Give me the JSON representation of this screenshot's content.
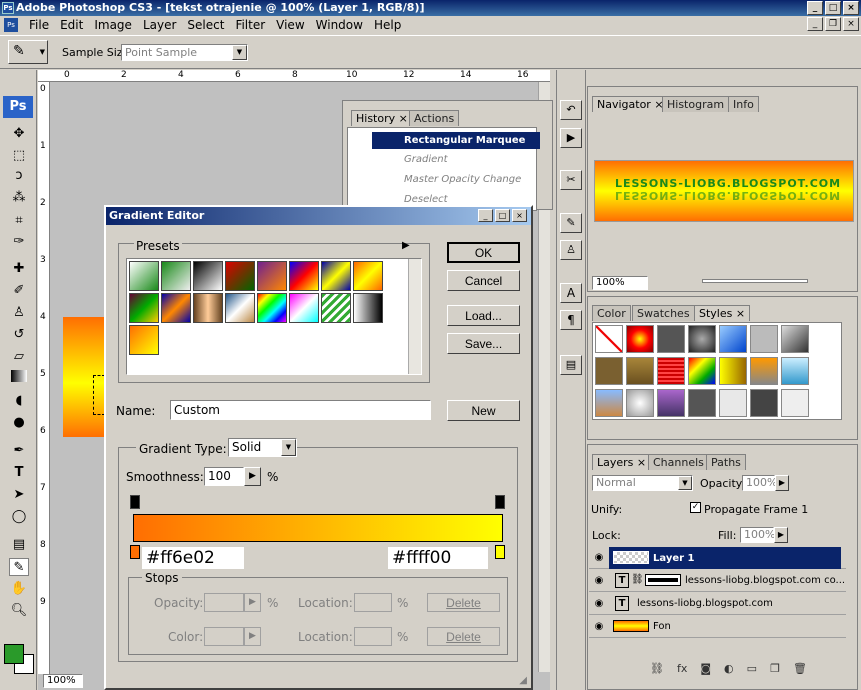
{
  "app": {
    "title": "Adobe Photoshop CS3 - [tekst otrajenie @ 100% (Layer 1, RGB/8)]",
    "logo": "Ps",
    "menu": [
      "File",
      "Edit",
      "Image",
      "Layer",
      "Select",
      "Filter",
      "View",
      "Window",
      "Help"
    ]
  },
  "options": {
    "sample_size_label": "Sample Size:",
    "sample_size_value": "Point Sample"
  },
  "ruler": {
    "ticks": [
      "0",
      "2",
      "4",
      "6",
      "8",
      "10",
      "12",
      "14",
      "16"
    ],
    "vticks": [
      "0",
      "1",
      "2",
      "3",
      "4",
      "5",
      "6",
      "7",
      "8",
      "9"
    ]
  },
  "history": {
    "tabs": [
      "History",
      "Actions"
    ],
    "items": [
      "Rectangular Marquee",
      "Gradient",
      "Master Opacity Change",
      "Deselect"
    ]
  },
  "gradient_editor": {
    "title": "Gradient Editor",
    "presets_label": "Presets",
    "ok": "OK",
    "cancel": "Cancel",
    "load": "Load...",
    "save": "Save...",
    "name_label": "Name:",
    "name_value": "Custom",
    "new_label": "New",
    "gradient_type_label": "Gradient Type:",
    "gradient_type_value": "Solid",
    "smoothness_label": "Smoothness:",
    "smoothness_value": "100",
    "smoothness_unit": "%",
    "left_color_label": "#ff6e02",
    "right_color_label": "#ffff00",
    "stops_label": "Stops",
    "opacity_label": "Opacity:",
    "opacity_unit": "%",
    "location_label": "Location:",
    "location_unit": "%",
    "delete_label": "Delete",
    "color_label": "Color:",
    "colors": {
      "start": "#ff6e02",
      "end": "#ffff00"
    }
  },
  "navigator": {
    "tabs": [
      "Navigator",
      "Histogram",
      "Info"
    ],
    "preview_text": "LESSONS-LIOBG.BLOGSPOT.COM",
    "zoom": "100%"
  },
  "styles": {
    "tabs": [
      "Color",
      "Swatches",
      "Styles"
    ]
  },
  "layers": {
    "tabs": [
      "Layers",
      "Channels",
      "Paths"
    ],
    "blend_mode": "Normal",
    "opacity_label": "Opacity:",
    "opacity_value": "100%",
    "unify_label": "Unify:",
    "propagate_label": "Propagate Frame 1",
    "lock_label": "Lock:",
    "fill_label": "Fill:",
    "fill_value": "100%",
    "rows": [
      "Layer 1",
      "lessons-liobg.blogspot.com co...",
      "lessons-liobg.blogspot.com",
      "Fon"
    ]
  },
  "status": {
    "zoom": "100%"
  }
}
